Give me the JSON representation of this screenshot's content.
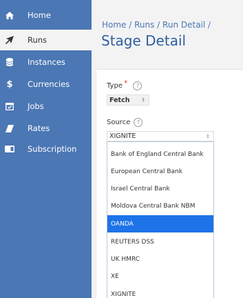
{
  "sidebar": {
    "items": [
      {
        "label": "Home",
        "icon": "home-icon"
      },
      {
        "label": "Runs",
        "icon": "rocket-icon",
        "active": true
      },
      {
        "label": "Instances",
        "icon": "database-icon"
      },
      {
        "label": "Currencies",
        "icon": "dollar-icon"
      },
      {
        "label": "Jobs",
        "icon": "calendar-check-icon"
      },
      {
        "label": "Rates",
        "icon": "eraser-icon"
      },
      {
        "label": "Subscription",
        "icon": "credit-card-icon"
      }
    ]
  },
  "header": {
    "breadcrumb": "Home / Runs / Run Detail /",
    "title": "Stage Detail"
  },
  "form": {
    "type_label": "Type",
    "required_mark": "*",
    "help_glyph": "?",
    "type_value": "Fetch",
    "source_label": "Source",
    "source_value": "XIGNITE",
    "caret_glyph": "↕"
  },
  "dropdown": {
    "options": [
      "Bank of England Central Bank",
      "European Central Bank",
      "Israel Central Bank",
      "Moldova Central Bank NBM",
      "OANDA",
      "REUTERS DSS",
      "UK HMRC",
      "XE",
      "XIGNITE"
    ],
    "highlighted": "OANDA"
  },
  "colors": {
    "sidebar_bg": "#4b77b4",
    "accent": "#2f5f9e",
    "selection": "#1e73e8"
  }
}
